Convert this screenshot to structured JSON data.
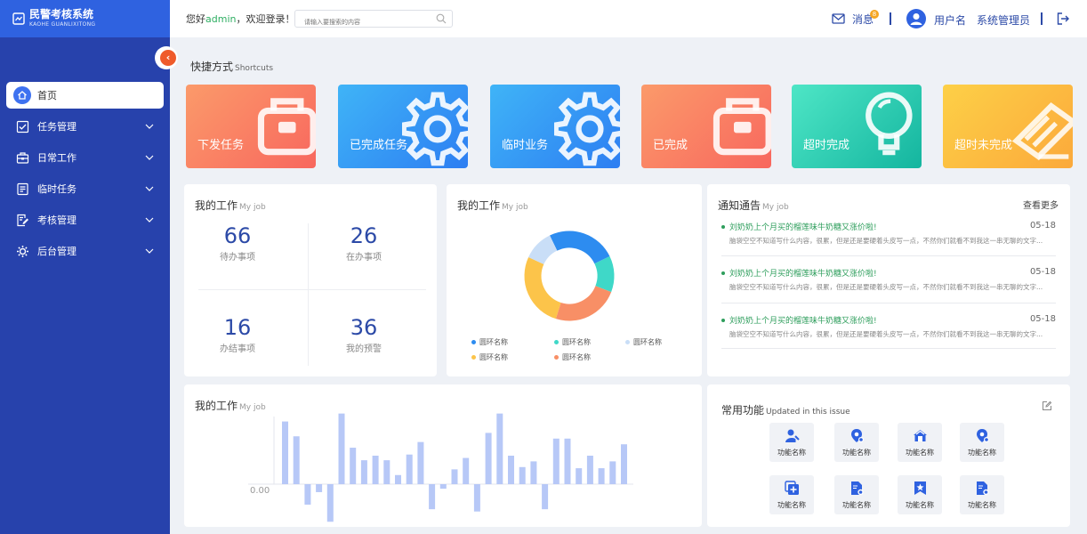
{
  "brand": {
    "title": "民警考核系统",
    "subtitle": "KAOHE GUANLIXITONG"
  },
  "colors": {
    "sidebar": "#2742ac",
    "brand_bar": "#2f62e0",
    "accent": "#2c4aa7",
    "green": "#2eae62",
    "collapse": "#ef5b2b"
  },
  "sidebar": {
    "items": [
      {
        "label": "首页",
        "icon": "home-icon",
        "active": true
      },
      {
        "label": "任务管理",
        "icon": "checklist-icon"
      },
      {
        "label": "日常工作",
        "icon": "briefcase-icon"
      },
      {
        "label": "临时任务",
        "icon": "document-icon"
      },
      {
        "label": "考核管理",
        "icon": "edit-doc-icon"
      },
      {
        "label": "后台管理",
        "icon": "settings-icon"
      }
    ]
  },
  "header": {
    "greet_prefix": "您好",
    "greet_user": "admin",
    "greet_suffix": "，欢迎登录！",
    "search_placeholder": "请输入要搜索的内容",
    "messages_label": "消息",
    "messages_count": "8",
    "username": "用户名",
    "role": "系统管理员"
  },
  "shortcuts": {
    "title": "快捷方式",
    "subtitle": "Shortcuts",
    "items": [
      {
        "label": "下发任务",
        "icon": "briefcase-icon",
        "gradient": [
          "#fb9a6a",
          "#f8675e"
        ]
      },
      {
        "label": "已完成任务",
        "icon": "gear-icon",
        "gradient": [
          "#3fb4f7",
          "#2d7ef2"
        ]
      },
      {
        "label": "临时业务",
        "icon": "gear-icon",
        "gradient": [
          "#3fb4f7",
          "#2d7ef2"
        ]
      },
      {
        "label": "已完成",
        "icon": "briefcase-icon",
        "gradient": [
          "#fb9a6a",
          "#f8675e"
        ]
      },
      {
        "label": "超时完成",
        "icon": "lightbulb-icon",
        "gradient": [
          "#4ee6c6",
          "#14b59f"
        ]
      },
      {
        "label": "超时未完成",
        "icon": "edit-icon",
        "gradient": [
          "#fdd047",
          "#fba93b"
        ]
      }
    ]
  },
  "my_work_stats": {
    "title": "我的工作",
    "subtitle": "My job",
    "items": [
      {
        "value": "66",
        "label": "待办事项"
      },
      {
        "value": "26",
        "label": "在办事项"
      },
      {
        "value": "16",
        "label": "办结事项"
      },
      {
        "value": "36",
        "label": "我的预警"
      }
    ]
  },
  "my_work_donut": {
    "title": "我的工作",
    "subtitle": "My job",
    "legend": [
      {
        "label": "圆环名称",
        "color": "#2d8cf0"
      },
      {
        "label": "圆环名称",
        "color": "#3fd8c8"
      },
      {
        "label": "圆环名称",
        "color": "#c9def7"
      },
      {
        "label": "圆环名称",
        "color": "#fcc44a"
      },
      {
        "label": "圆环名称",
        "color": "#f88f66"
      }
    ]
  },
  "notices": {
    "title": "通知通告",
    "subtitle": "My job",
    "more": "查看更多",
    "items": [
      {
        "headline": "刘奶奶上个月买的榴莲味牛奶糖又涨价啦!",
        "date": "05-18",
        "body": "脑袋空空不知道写什么内容，很累，但是还是要硬着头皮写一点，不然你们就看不到我这一串无聊的文字..."
      },
      {
        "headline": "刘奶奶上个月买的榴莲味牛奶糖又涨价啦!",
        "date": "05-18",
        "body": "脑袋空空不知道写什么内容，很累，但是还是要硬着头皮写一点，不然你们就看不到我这一串无聊的文字..."
      },
      {
        "headline": "刘奶奶上个月买的榴莲味牛奶糖又涨价啦!",
        "date": "05-18",
        "body": "脑袋空空不知道写什么内容，很累，但是还是要硬着头皮写一点，不然你们就看不到我这一串无聊的文字..."
      }
    ]
  },
  "bar_chart": {
    "title": "我的工作",
    "subtitle": "My job",
    "zero_label": "0.00"
  },
  "chart_data": [
    {
      "type": "pie",
      "donut": true,
      "series": [
        {
          "value": 25,
          "color": "#2d8cf0"
        },
        {
          "value": 13,
          "color": "#3fd8c8"
        },
        {
          "value": 24,
          "color": "#f88f66"
        },
        {
          "value": 27,
          "color": "#fcc44a"
        },
        {
          "value": 11,
          "color": "#c9def7"
        }
      ]
    },
    {
      "type": "bar",
      "values": [
        0.55,
        0.42,
        -0.18,
        -0.07,
        -0.33,
        0.62,
        0.32,
        0.21,
        0.25,
        0.21,
        0.08,
        0.26,
        0.37,
        -0.22,
        -0.04,
        0.13,
        0.23,
        -0.24,
        0.45,
        0.62,
        0.25,
        0.15,
        0.2,
        -0.22,
        0.4,
        0.4,
        0.14,
        0.25,
        0.14,
        0.2,
        0.35
      ],
      "ylim": [
        -0.33,
        0.62
      ]
    }
  ],
  "functions": {
    "title": "常用功能",
    "subtitle": "Updated in this issue",
    "items": [
      {
        "label": "功能名称",
        "icon": "user-settings-icon"
      },
      {
        "label": "功能名称",
        "icon": "location-gear-icon"
      },
      {
        "label": "功能名称",
        "icon": "house-icon"
      },
      {
        "label": "功能名称",
        "icon": "location-gear-icon"
      },
      {
        "label": "功能名称",
        "icon": "add-box-icon"
      },
      {
        "label": "功能名称",
        "icon": "file-gear-icon"
      },
      {
        "label": "功能名称",
        "icon": "bookmark-star-icon"
      },
      {
        "label": "功能名称",
        "icon": "file-gear-icon"
      }
    ]
  }
}
